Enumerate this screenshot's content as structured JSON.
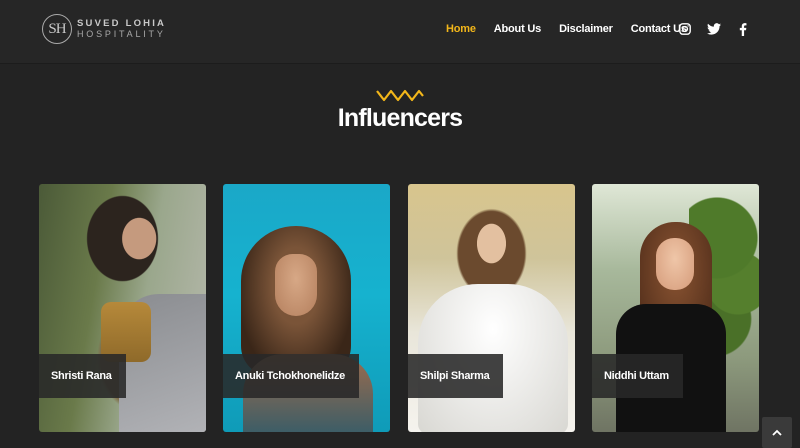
{
  "brand": {
    "mark": "SH",
    "line1": "SUVED LOHIA",
    "line2": "HOSPITALITY"
  },
  "nav": {
    "items": [
      {
        "label": "Home",
        "active": true
      },
      {
        "label": "About Us",
        "active": false
      },
      {
        "label": "Disclaimer",
        "active": false
      },
      {
        "label": "Contact Us",
        "active": false
      }
    ],
    "social_icons": [
      "instagram-icon",
      "twitter-icon",
      "facebook-icon"
    ]
  },
  "section": {
    "title": "Influencers",
    "accent_color": "#f2b61a"
  },
  "influencers": [
    {
      "name": "Shristi Rana"
    },
    {
      "name": "Anuki Tchokhonelidze"
    },
    {
      "name": "Shilpi Sharma"
    },
    {
      "name": "Niddhi Uttam"
    }
  ],
  "colors": {
    "background": "#232323",
    "nav_active": "#f2b61a"
  }
}
